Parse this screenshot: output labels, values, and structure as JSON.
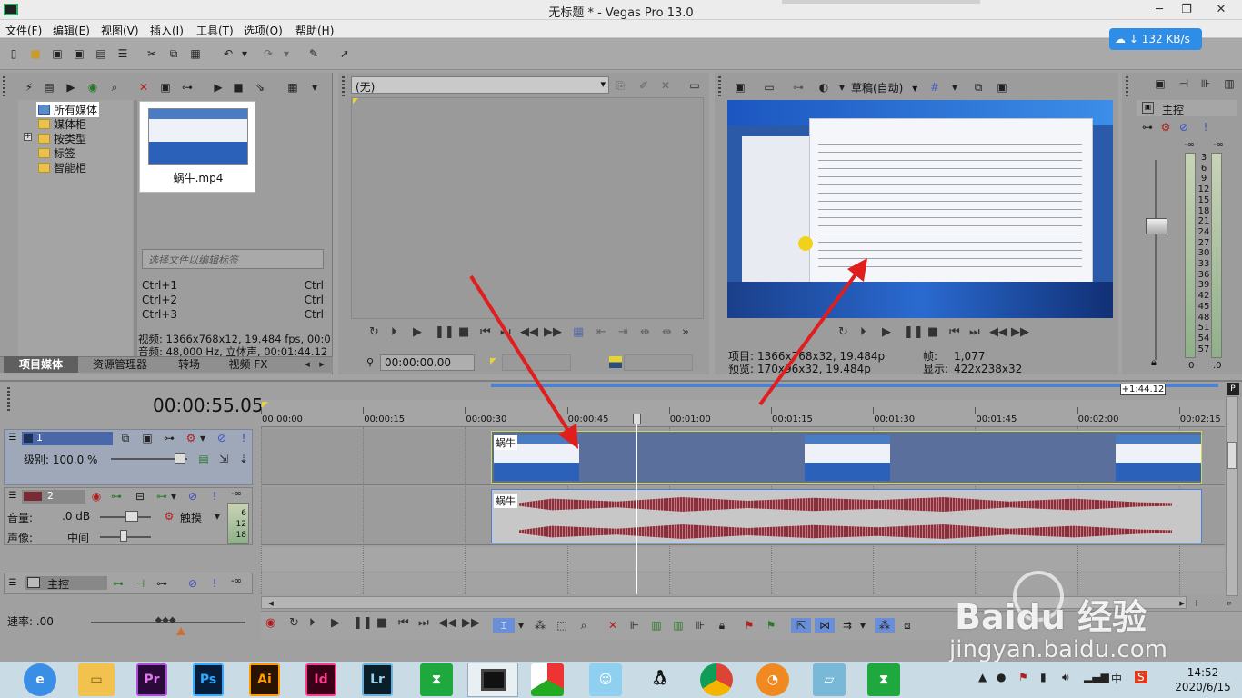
{
  "window": {
    "title": "无标题 * - Vegas Pro 13.0"
  },
  "menu": [
    "文件(F)",
    "编辑(E)",
    "视图(V)",
    "插入(I)",
    "工具(T)",
    "选项(O)",
    "帮助(H)"
  ],
  "net_speed": "132 KB/s",
  "media": {
    "tree": [
      "所有媒体",
      "媒体柜",
      "按类型",
      "标签",
      "智能柜"
    ],
    "file_name": "蜗牛.mp4",
    "tag_placeholder": "选择文件以编辑标签",
    "shortcuts": [
      {
        "key": "Ctrl+1",
        "right": "Ctrl"
      },
      {
        "key": "Ctrl+2",
        "right": "Ctrl"
      },
      {
        "key": "Ctrl+3",
        "right": "Ctrl"
      }
    ],
    "video_info": "视频: 1366x768x12, 19.484 fps, 00:0",
    "audio_info": "音频: 48,000 Hz, 立体声, 00:01:44.12",
    "tabs": [
      "项目媒体",
      "资源管理器",
      "转场",
      "视频 FX"
    ]
  },
  "trimmer": {
    "dropdown": "(无)",
    "timecode": "00:00:00.00"
  },
  "preview": {
    "quality": "草稿(自动)",
    "project_label": "项目:",
    "project_value": "1366x768x32, 19.484p",
    "preview_label": "预览:",
    "preview_value": "170x96x32, 19.484p",
    "frame_label": "帧:",
    "frame_value": "1,077",
    "display_label": "显示:",
    "display_value": "422x238x32"
  },
  "master": {
    "label": "主控",
    "scale_top": "-∞",
    "scale": [
      "3",
      "6",
      "9",
      "12",
      "15",
      "18",
      "21",
      "24",
      "27",
      "30",
      "33",
      "36",
      "39",
      "42",
      "45",
      "48",
      "51",
      "54",
      "57"
    ],
    "bottom_left": ".0",
    "bottom_right": ".0"
  },
  "timeline": {
    "current_time": "00:00:55.05",
    "length_badge": "+1:44.12",
    "ruler": [
      "00:00:00",
      "00:00:15",
      "00:00:30",
      "00:00:45",
      "00:01:00",
      "00:01:15",
      "00:01:30",
      "00:01:45",
      "00:02:00",
      "00:02:15"
    ],
    "video_track": {
      "number": "1",
      "level_label": "级别: 100.0 %",
      "clip_label": "蜗牛"
    },
    "audio_track": {
      "number": "2",
      "volume_label": "音量:",
      "volume_value": ".0 dB",
      "pan_label": "声像:",
      "pan_value": "中间",
      "touch_label": "触摸",
      "meter": [
        "-∞",
        "6",
        "12",
        "18"
      ],
      "clip_label": "蜗牛"
    },
    "master_bus": {
      "label": "主控",
      "meter": "-∞"
    },
    "rate_label": "速率: .00"
  },
  "taskbar": {
    "apps": [
      "Pr",
      "Ps",
      "Ai",
      "Id",
      "Lr"
    ],
    "clock_time": "14:52",
    "clock_date": "2020/6/15",
    "ime": "中"
  },
  "watermark": {
    "brand": "Baidu 经验",
    "url": "jingyan.baidu.com"
  },
  "colors": {
    "accent": "#2e8de6",
    "arrow": "#e01e1e",
    "clip_border": "#d6d64a",
    "wave": "#8b2f3b"
  }
}
